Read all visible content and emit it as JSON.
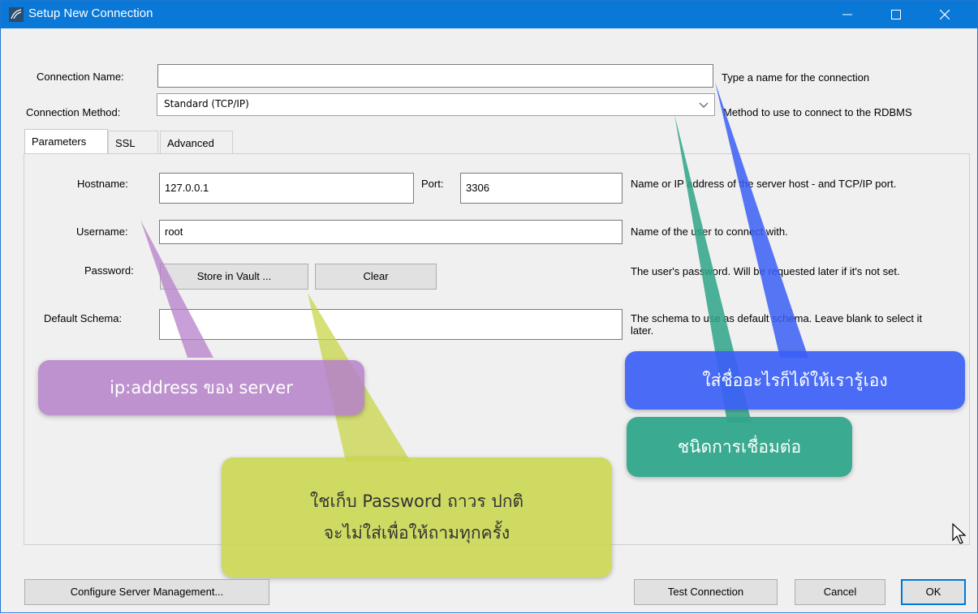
{
  "window": {
    "title": "Setup New Connection",
    "controls": {
      "minimize": "—",
      "maximize": "☐",
      "close": "✕"
    }
  },
  "connection_name": {
    "label": "Connection Name:",
    "value": "",
    "hint": "Type a name for the connection"
  },
  "connection_method": {
    "label": "Connection Method:",
    "value": "Standard (TCP/IP)",
    "hint": "Method to use to connect to the RDBMS"
  },
  "tabs": [
    {
      "label": "Parameters",
      "active": true
    },
    {
      "label": "SSL",
      "active": false
    },
    {
      "label": "Advanced",
      "active": false
    }
  ],
  "parameters": {
    "hostname": {
      "label": "Hostname:",
      "value": "127.0.0.1"
    },
    "port": {
      "label": "Port:",
      "value": "3306"
    },
    "host_hint": "Name or IP address of the server host - and TCP/IP port.",
    "username": {
      "label": "Username:",
      "value": "root",
      "hint": "Name of the user to connect with."
    },
    "password": {
      "label": "Password:",
      "store_button": "Store in Vault ...",
      "clear_button": "Clear",
      "hint": "The user's password. Will be requested later if it's not set."
    },
    "default_schema": {
      "label": "Default Schema:",
      "value": "",
      "hint": "The schema to use as default schema. Leave blank to select it later."
    }
  },
  "annotations": {
    "ip_address": {
      "text": "ip:address ของ server",
      "color": "#b580c9"
    },
    "password_note": {
      "line1": "ใชเก็บ Password ถาวร ปกติ",
      "line2": "จะไม่ใส่เพื่อให้ถามทุกครั้ง",
      "color": "#c9d64a"
    },
    "name_note": {
      "text": "ใส่ชื่ออะไรก็ได้ให้เรารู้เอง",
      "color": "#3b5ff5"
    },
    "method_note": {
      "text": "ชนิดการเชื่อมต่อ",
      "color": "#2fa58a"
    }
  },
  "footer": {
    "configure_button": "Configure Server Management...",
    "test_button": "Test Connection",
    "cancel_button": "Cancel",
    "ok_button": "OK"
  }
}
